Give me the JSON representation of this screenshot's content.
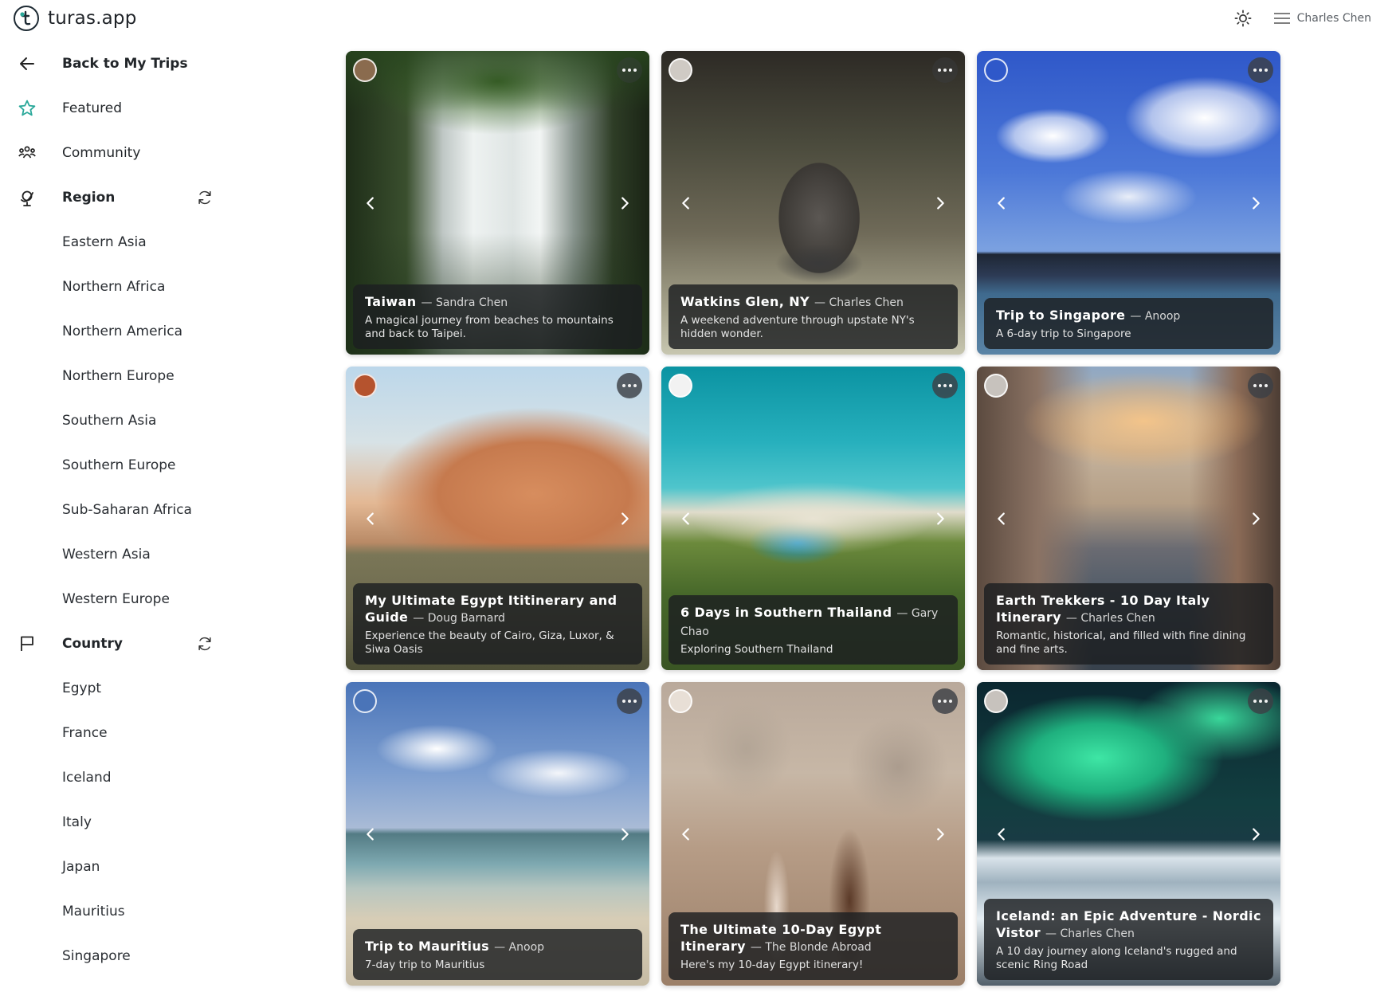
{
  "app": {
    "name": "turas.app"
  },
  "header": {
    "user_name": "Charles Chen",
    "theme_icon": "sun-icon",
    "menu_icon": "menu-icon"
  },
  "sidebar": {
    "back_label": "Back to My Trips",
    "featured_label": "Featured",
    "community_label": "Community",
    "region_label": "Region",
    "regions": [
      "Eastern Asia",
      "Northern Africa",
      "Northern America",
      "Northern Europe",
      "Southern Asia",
      "Southern Europe",
      "Sub-Saharan Africa",
      "Western Asia",
      "Western Europe"
    ],
    "country_label": "Country",
    "countries": [
      "Egypt",
      "France",
      "Iceland",
      "Italy",
      "Japan",
      "Mauritius",
      "Singapore"
    ]
  },
  "cards": [
    {
      "title": "Taiwan",
      "author": "Sandra Chen",
      "description": "A magical journey from beaches to mountains and back to Taipei.",
      "avatar_color": "#8a6b4e",
      "menu_visible": "faint"
    },
    {
      "title": "Watkins Glen, NY",
      "author": "Charles Chen",
      "description": "A weekend adventure through upstate NY's hidden wonder.",
      "avatar_color": "#cfcac4",
      "menu_visible": "faint"
    },
    {
      "title": "Trip to Singapore",
      "author": "Anoop",
      "description": "A 6-day trip to Singapore",
      "avatar_color": "#2f58c9",
      "menu_visible": "dark"
    },
    {
      "title": "My Ultimate Egypt Ititinerary and Guide",
      "author": "Doug Barnard",
      "description": "Experience the beauty of Cairo, Giza, Luxor, & Siwa Oasis",
      "avatar_color": "#b5532e",
      "menu_visible": "dark"
    },
    {
      "title": "6 Days in Southern Thailand",
      "author": "Gary Chao",
      "description": "Exploring Southern Thailand",
      "avatar_color": "#f2f2f2",
      "menu_visible": "dark"
    },
    {
      "title": "Earth Trekkers - 10 Day Italy Itinerary",
      "author": "Charles Chen",
      "description": "Romantic, historical, and filled with fine dining and fine arts.",
      "avatar_color": "#c7c2bd",
      "menu_visible": "dark"
    },
    {
      "title": "Trip to Mauritius",
      "author": "Anoop",
      "description": "7-day trip to Mauritius",
      "avatar_color": "#4a74b8",
      "menu_visible": "dark"
    },
    {
      "title": "The Ultimate 10-Day Egypt Itinerary",
      "author": "The Blonde Abroad",
      "description": "Here's my 10-day Egypt itinerary!",
      "avatar_color": "#e8dfd6",
      "menu_visible": "dark"
    },
    {
      "title": "Iceland: an Epic Adventure - Nordic Vistor",
      "author": "Charles Chen",
      "description": "A 10 day journey along Iceland's rugged and scenic Ring Road",
      "avatar_color": "#c7c2bd",
      "menu_visible": "dark"
    }
  ]
}
